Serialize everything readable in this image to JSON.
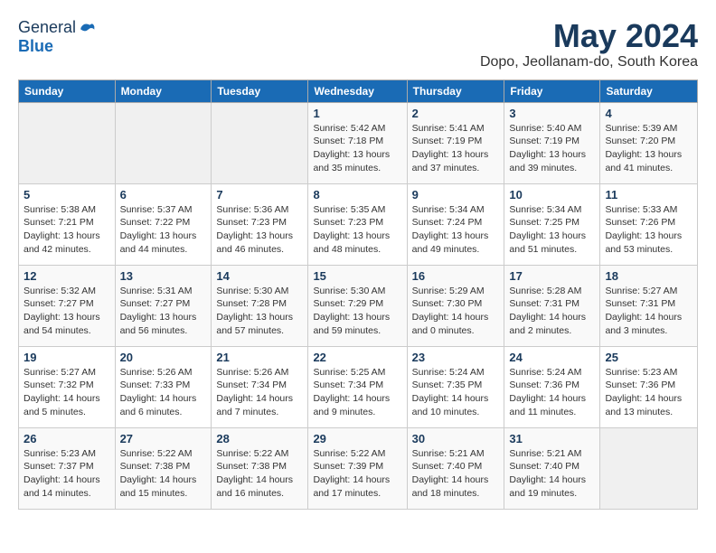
{
  "logo": {
    "general": "General",
    "blue": "Blue"
  },
  "title": {
    "month": "May 2024",
    "location": "Dopo, Jeollanam-do, South Korea"
  },
  "weekdays": [
    "Sunday",
    "Monday",
    "Tuesday",
    "Wednesday",
    "Thursday",
    "Friday",
    "Saturday"
  ],
  "weeks": [
    [
      {
        "day": "",
        "info": ""
      },
      {
        "day": "",
        "info": ""
      },
      {
        "day": "",
        "info": ""
      },
      {
        "day": "1",
        "sunrise": "Sunrise: 5:42 AM",
        "sunset": "Sunset: 7:18 PM",
        "daylight": "Daylight: 13 hours and 35 minutes."
      },
      {
        "day": "2",
        "sunrise": "Sunrise: 5:41 AM",
        "sunset": "Sunset: 7:19 PM",
        "daylight": "Daylight: 13 hours and 37 minutes."
      },
      {
        "day": "3",
        "sunrise": "Sunrise: 5:40 AM",
        "sunset": "Sunset: 7:19 PM",
        "daylight": "Daylight: 13 hours and 39 minutes."
      },
      {
        "day": "4",
        "sunrise": "Sunrise: 5:39 AM",
        "sunset": "Sunset: 7:20 PM",
        "daylight": "Daylight: 13 hours and 41 minutes."
      }
    ],
    [
      {
        "day": "5",
        "sunrise": "Sunrise: 5:38 AM",
        "sunset": "Sunset: 7:21 PM",
        "daylight": "Daylight: 13 hours and 42 minutes."
      },
      {
        "day": "6",
        "sunrise": "Sunrise: 5:37 AM",
        "sunset": "Sunset: 7:22 PM",
        "daylight": "Daylight: 13 hours and 44 minutes."
      },
      {
        "day": "7",
        "sunrise": "Sunrise: 5:36 AM",
        "sunset": "Sunset: 7:23 PM",
        "daylight": "Daylight: 13 hours and 46 minutes."
      },
      {
        "day": "8",
        "sunrise": "Sunrise: 5:35 AM",
        "sunset": "Sunset: 7:23 PM",
        "daylight": "Daylight: 13 hours and 48 minutes."
      },
      {
        "day": "9",
        "sunrise": "Sunrise: 5:34 AM",
        "sunset": "Sunset: 7:24 PM",
        "daylight": "Daylight: 13 hours and 49 minutes."
      },
      {
        "day": "10",
        "sunrise": "Sunrise: 5:34 AM",
        "sunset": "Sunset: 7:25 PM",
        "daylight": "Daylight: 13 hours and 51 minutes."
      },
      {
        "day": "11",
        "sunrise": "Sunrise: 5:33 AM",
        "sunset": "Sunset: 7:26 PM",
        "daylight": "Daylight: 13 hours and 53 minutes."
      }
    ],
    [
      {
        "day": "12",
        "sunrise": "Sunrise: 5:32 AM",
        "sunset": "Sunset: 7:27 PM",
        "daylight": "Daylight: 13 hours and 54 minutes."
      },
      {
        "day": "13",
        "sunrise": "Sunrise: 5:31 AM",
        "sunset": "Sunset: 7:27 PM",
        "daylight": "Daylight: 13 hours and 56 minutes."
      },
      {
        "day": "14",
        "sunrise": "Sunrise: 5:30 AM",
        "sunset": "Sunset: 7:28 PM",
        "daylight": "Daylight: 13 hours and 57 minutes."
      },
      {
        "day": "15",
        "sunrise": "Sunrise: 5:30 AM",
        "sunset": "Sunset: 7:29 PM",
        "daylight": "Daylight: 13 hours and 59 minutes."
      },
      {
        "day": "16",
        "sunrise": "Sunrise: 5:29 AM",
        "sunset": "Sunset: 7:30 PM",
        "daylight": "Daylight: 14 hours and 0 minutes."
      },
      {
        "day": "17",
        "sunrise": "Sunrise: 5:28 AM",
        "sunset": "Sunset: 7:31 PM",
        "daylight": "Daylight: 14 hours and 2 minutes."
      },
      {
        "day": "18",
        "sunrise": "Sunrise: 5:27 AM",
        "sunset": "Sunset: 7:31 PM",
        "daylight": "Daylight: 14 hours and 3 minutes."
      }
    ],
    [
      {
        "day": "19",
        "sunrise": "Sunrise: 5:27 AM",
        "sunset": "Sunset: 7:32 PM",
        "daylight": "Daylight: 14 hours and 5 minutes."
      },
      {
        "day": "20",
        "sunrise": "Sunrise: 5:26 AM",
        "sunset": "Sunset: 7:33 PM",
        "daylight": "Daylight: 14 hours and 6 minutes."
      },
      {
        "day": "21",
        "sunrise": "Sunrise: 5:26 AM",
        "sunset": "Sunset: 7:34 PM",
        "daylight": "Daylight: 14 hours and 7 minutes."
      },
      {
        "day": "22",
        "sunrise": "Sunrise: 5:25 AM",
        "sunset": "Sunset: 7:34 PM",
        "daylight": "Daylight: 14 hours and 9 minutes."
      },
      {
        "day": "23",
        "sunrise": "Sunrise: 5:24 AM",
        "sunset": "Sunset: 7:35 PM",
        "daylight": "Daylight: 14 hours and 10 minutes."
      },
      {
        "day": "24",
        "sunrise": "Sunrise: 5:24 AM",
        "sunset": "Sunset: 7:36 PM",
        "daylight": "Daylight: 14 hours and 11 minutes."
      },
      {
        "day": "25",
        "sunrise": "Sunrise: 5:23 AM",
        "sunset": "Sunset: 7:36 PM",
        "daylight": "Daylight: 14 hours and 13 minutes."
      }
    ],
    [
      {
        "day": "26",
        "sunrise": "Sunrise: 5:23 AM",
        "sunset": "Sunset: 7:37 PM",
        "daylight": "Daylight: 14 hours and 14 minutes."
      },
      {
        "day": "27",
        "sunrise": "Sunrise: 5:22 AM",
        "sunset": "Sunset: 7:38 PM",
        "daylight": "Daylight: 14 hours and 15 minutes."
      },
      {
        "day": "28",
        "sunrise": "Sunrise: 5:22 AM",
        "sunset": "Sunset: 7:38 PM",
        "daylight": "Daylight: 14 hours and 16 minutes."
      },
      {
        "day": "29",
        "sunrise": "Sunrise: 5:22 AM",
        "sunset": "Sunset: 7:39 PM",
        "daylight": "Daylight: 14 hours and 17 minutes."
      },
      {
        "day": "30",
        "sunrise": "Sunrise: 5:21 AM",
        "sunset": "Sunset: 7:40 PM",
        "daylight": "Daylight: 14 hours and 18 minutes."
      },
      {
        "day": "31",
        "sunrise": "Sunrise: 5:21 AM",
        "sunset": "Sunset: 7:40 PM",
        "daylight": "Daylight: 14 hours and 19 minutes."
      },
      {
        "day": "",
        "info": ""
      }
    ]
  ]
}
